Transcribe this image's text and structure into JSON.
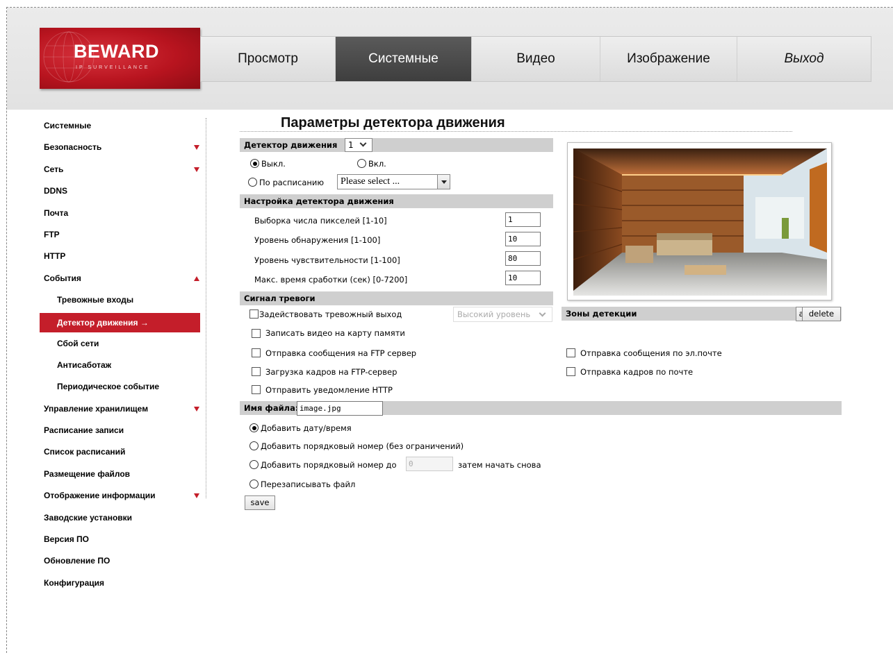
{
  "brand": {
    "logo_text": "BEWARD",
    "logo_sub": "IP SURVEILLANCE"
  },
  "topnav": {
    "tabs": [
      "Просмотр",
      "Системные",
      "Видео",
      "Изображение",
      "Выход"
    ],
    "active": "Системные"
  },
  "sidebar": {
    "items": [
      {
        "label": "Системные"
      },
      {
        "label": "Безопасность"
      },
      {
        "label": "Сеть"
      },
      {
        "label": "DDNS"
      },
      {
        "label": "Почта"
      },
      {
        "label": "FTP"
      },
      {
        "label": "HTTP"
      },
      {
        "label": "События"
      },
      {
        "label": "Тревожные входы"
      },
      {
        "label": "Детектор движения →"
      },
      {
        "label": "Сбой сети"
      },
      {
        "label": "Антисаботаж"
      },
      {
        "label": "Периодическое событие"
      },
      {
        "label": "Управление хранилищем"
      },
      {
        "label": "Расписание записи"
      },
      {
        "label": "Список расписаний"
      },
      {
        "label": "Размещение файлов"
      },
      {
        "label": "Отображение информации"
      },
      {
        "label": "Заводские установки"
      },
      {
        "label": "Версия ПО"
      },
      {
        "label": "Обновление ПО"
      },
      {
        "label": "Конфигурация"
      }
    ]
  },
  "page": {
    "title": "Параметры детектора движения"
  },
  "detector": {
    "label": "Детектор движения",
    "selected": "1",
    "off_label": "Выкл.",
    "on_label": "Вкл.",
    "schedule_label": "По расписанию",
    "schedule_placeholder": "Please select ...",
    "mode": "off"
  },
  "settings": {
    "header": "Настройка детектора движения",
    "fields": [
      {
        "label": "Выборка числа пикселей [1-10]",
        "value": "1"
      },
      {
        "label": "Уровень обнаружения [1-100]",
        "value": "10"
      },
      {
        "label": "Уровень чувствительности [1-100]",
        "value": "80"
      },
      {
        "label": "Макс. время сработки (сек) [0-7200]",
        "value": "10"
      }
    ]
  },
  "alarm": {
    "header": "Сигнал тревоги",
    "output_label": "Задействовать тревожный выход",
    "output_level": "Высокий уровень",
    "record_label": "Записать видео на карту памяти",
    "ftp_msg_label": "Отправка сообщения на FTP сервер",
    "ftp_upload_label": "Загрузка кадров на FTP-сервер",
    "http_label": "Отправить уведомление HTTP",
    "email_msg_label": "Отправка сообщения по эл.почте",
    "email_frames_label": "Отправка кадров по почте"
  },
  "zones": {
    "label": "Зоны детекции",
    "add": "add",
    "delete": "delete"
  },
  "filename": {
    "label": "Имя файла:",
    "value": "image.jpg",
    "opt_datetime": "Добавить дату/время",
    "opt_seq": "Добавить порядковый номер (без ограничений)",
    "opt_seq_upto": "Добавить порядковый номер до",
    "upto_value": "0",
    "opt_seq_suffix": "затем начать снова",
    "opt_overwrite": "Перезаписывать файл",
    "selected": "datetime"
  },
  "save_label": "save",
  "colors": {
    "accent": "#c41e2a",
    "bar": "#cfcfcf",
    "nav_active": "#474747"
  },
  "icons": {
    "dropdown": "chevron-down-icon",
    "expand": "triangle-icon"
  }
}
